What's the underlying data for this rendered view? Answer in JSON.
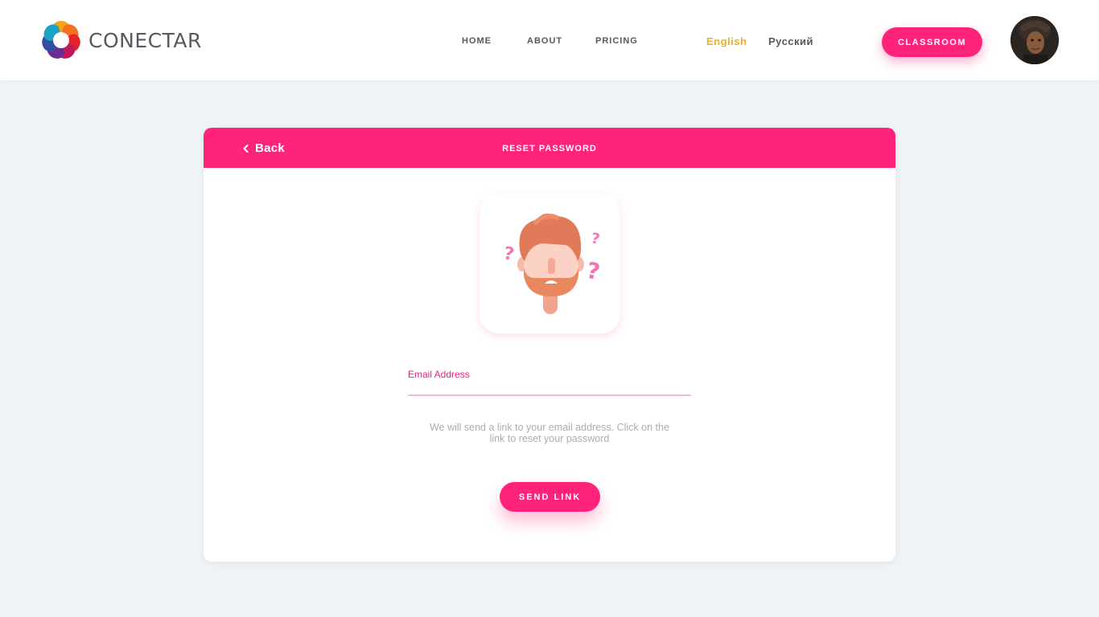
{
  "brand": {
    "name": "CONECTAR",
    "logo_icon": "flower-logo-icon"
  },
  "nav": {
    "items": [
      {
        "label": "HOME"
      },
      {
        "label": "ABOUT"
      },
      {
        "label": "PRICING"
      }
    ]
  },
  "languages": {
    "active": "English",
    "other": "Русский",
    "active_color": "#f0b01e",
    "other_color": "#555a5f"
  },
  "header_button": {
    "label": "CLASSROOM"
  },
  "user": {
    "avatar_icon": "user-avatar"
  },
  "card": {
    "back_label": "Back",
    "title": "RESET PASSWORD",
    "illustration": "confused-bearded-man-icon",
    "email_label": "Email Address",
    "email_value": "",
    "hint": "We will send a link to your email address. Click on the link to reset your password",
    "send_label": "SEND LINK"
  },
  "colors": {
    "accent": "#ff237b",
    "page_background": "#eef3f6",
    "field_label": "#e2267a",
    "hint_text": "#a9adb1"
  }
}
